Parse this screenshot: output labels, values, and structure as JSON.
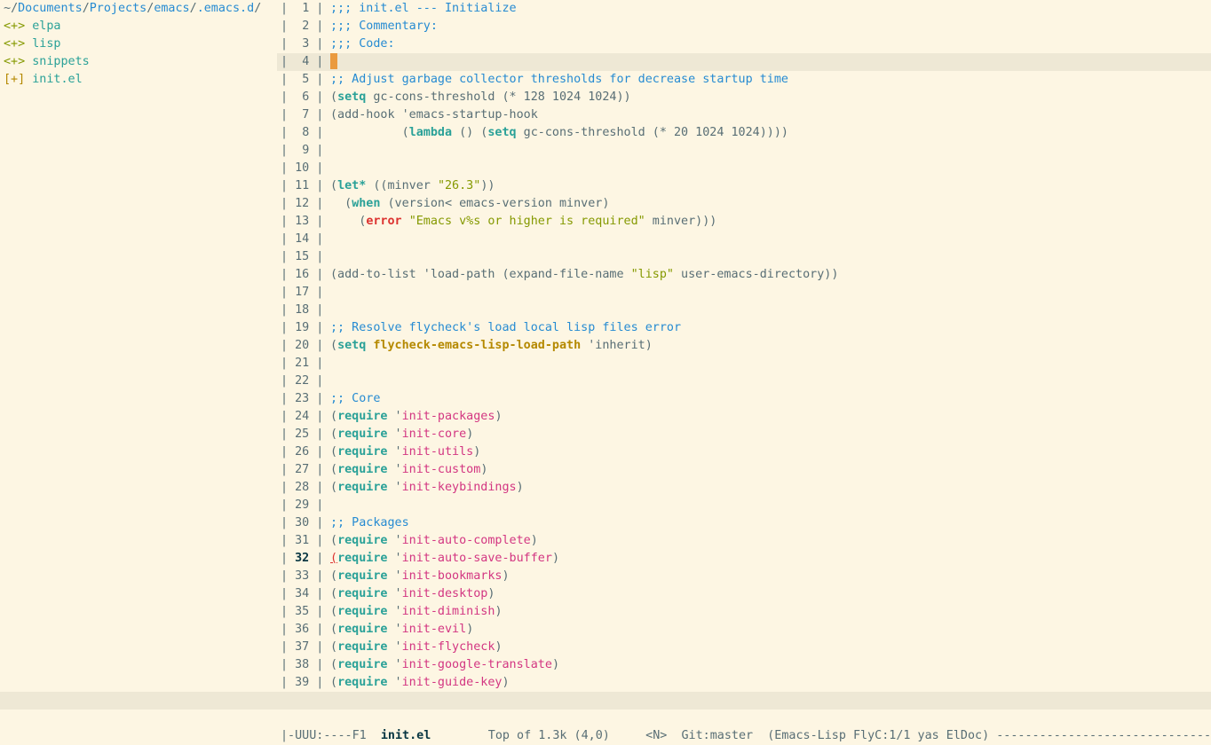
{
  "neotree": {
    "path": {
      "prefix": "~",
      "seg1": "Documents",
      "seg2": "Projects",
      "seg3": "emacs",
      "seg4": ".emacs.d",
      "sep": "/"
    },
    "dirs": [
      {
        "mark": "<+>",
        "name": "elpa"
      },
      {
        "mark": "<+>",
        "name": "lisp"
      },
      {
        "mark": "<+>",
        "name": "snippets"
      }
    ],
    "files": [
      {
        "mark": "[+]",
        "name": "init.el"
      }
    ]
  },
  "editor": {
    "lines": [
      {
        "n": "1",
        "code": [
          {
            "t": ";;; init.el --- Initialize",
            "c": "comment"
          }
        ]
      },
      {
        "n": "2",
        "code": [
          {
            "t": ";;; Commentary:",
            "c": "comment"
          }
        ]
      },
      {
        "n": "3",
        "code": [
          {
            "t": ";;; Code:",
            "c": "comment"
          }
        ]
      },
      {
        "n": "4",
        "code": [],
        "cursor": true
      },
      {
        "n": "5",
        "code": [
          {
            "t": ";; Adjust garbage collector thresholds for decrease startup time",
            "c": "comment"
          }
        ]
      },
      {
        "n": "6",
        "code": [
          {
            "t": "(",
            "c": ""
          },
          {
            "t": "setq",
            "c": "kw"
          },
          {
            "t": " gc-cons-threshold (* 128 1024 1024))",
            "c": ""
          }
        ]
      },
      {
        "n": "7",
        "code": [
          {
            "t": "(add-hook 'emacs-startup-hook",
            "c": ""
          }
        ]
      },
      {
        "n": "8",
        "code": [
          {
            "t": "          (",
            "c": ""
          },
          {
            "t": "lambda",
            "c": "kw"
          },
          {
            "t": " () (",
            "c": ""
          },
          {
            "t": "setq",
            "c": "kw"
          },
          {
            "t": " gc-cons-threshold (* 20 1024 1024))))",
            "c": ""
          }
        ]
      },
      {
        "n": "9",
        "code": []
      },
      {
        "n": "10",
        "code": []
      },
      {
        "n": "11",
        "code": [
          {
            "t": "(",
            "c": ""
          },
          {
            "t": "let*",
            "c": "kw"
          },
          {
            "t": " ((minver ",
            "c": ""
          },
          {
            "t": "\"26.3\"",
            "c": "str"
          },
          {
            "t": "))",
            "c": ""
          }
        ]
      },
      {
        "n": "12",
        "code": [
          {
            "t": "  (",
            "c": ""
          },
          {
            "t": "when",
            "c": "kw"
          },
          {
            "t": " (version< emacs-version minver)",
            "c": ""
          }
        ]
      },
      {
        "n": "13",
        "code": [
          {
            "t": "    (",
            "c": ""
          },
          {
            "t": "error",
            "c": "err"
          },
          {
            "t": " ",
            "c": ""
          },
          {
            "t": "\"Emacs v%s or higher is required\"",
            "c": "str"
          },
          {
            "t": " minver)))",
            "c": ""
          }
        ]
      },
      {
        "n": "14",
        "code": []
      },
      {
        "n": "15",
        "code": []
      },
      {
        "n": "16",
        "code": [
          {
            "t": "(add-to-list 'load-path (expand-file-name ",
            "c": ""
          },
          {
            "t": "\"lisp\"",
            "c": "str"
          },
          {
            "t": " user-emacs-directory))",
            "c": ""
          }
        ]
      },
      {
        "n": "17",
        "code": []
      },
      {
        "n": "18",
        "code": []
      },
      {
        "n": "19",
        "code": [
          {
            "t": ";; Resolve flycheck's load local lisp files error",
            "c": "comment"
          }
        ]
      },
      {
        "n": "20",
        "code": [
          {
            "t": "(",
            "c": ""
          },
          {
            "t": "setq",
            "c": "kw"
          },
          {
            "t": " ",
            "c": ""
          },
          {
            "t": "flycheck-emacs-lisp-load-path",
            "c": "var"
          },
          {
            "t": " 'inherit)",
            "c": ""
          }
        ]
      },
      {
        "n": "21",
        "code": []
      },
      {
        "n": "22",
        "code": []
      },
      {
        "n": "23",
        "code": [
          {
            "t": ";; Core",
            "c": "comment"
          }
        ]
      },
      {
        "n": "24",
        "code": [
          {
            "t": "(",
            "c": ""
          },
          {
            "t": "require",
            "c": "kw"
          },
          {
            "t": " '",
            "c": ""
          },
          {
            "t": "init-packages",
            "c": "sym"
          },
          {
            "t": ")",
            "c": ""
          }
        ]
      },
      {
        "n": "25",
        "code": [
          {
            "t": "(",
            "c": ""
          },
          {
            "t": "require",
            "c": "kw"
          },
          {
            "t": " '",
            "c": ""
          },
          {
            "t": "init-core",
            "c": "sym"
          },
          {
            "t": ")",
            "c": ""
          }
        ]
      },
      {
        "n": "26",
        "code": [
          {
            "t": "(",
            "c": ""
          },
          {
            "t": "require",
            "c": "kw"
          },
          {
            "t": " '",
            "c": ""
          },
          {
            "t": "init-utils",
            "c": "sym"
          },
          {
            "t": ")",
            "c": ""
          }
        ]
      },
      {
        "n": "27",
        "code": [
          {
            "t": "(",
            "c": ""
          },
          {
            "t": "require",
            "c": "kw"
          },
          {
            "t": " '",
            "c": ""
          },
          {
            "t": "init-custom",
            "c": "sym"
          },
          {
            "t": ")",
            "c": ""
          }
        ]
      },
      {
        "n": "28",
        "code": [
          {
            "t": "(",
            "c": ""
          },
          {
            "t": "require",
            "c": "kw"
          },
          {
            "t": " '",
            "c": ""
          },
          {
            "t": "init-keybindings",
            "c": "sym"
          },
          {
            "t": ")",
            "c": ""
          }
        ]
      },
      {
        "n": "29",
        "code": []
      },
      {
        "n": "30",
        "code": [
          {
            "t": ";; Packages",
            "c": "comment"
          }
        ]
      },
      {
        "n": "31",
        "code": [
          {
            "t": "(",
            "c": ""
          },
          {
            "t": "require",
            "c": "kw"
          },
          {
            "t": " '",
            "c": ""
          },
          {
            "t": "init-auto-complete",
            "c": "sym"
          },
          {
            "t": ")",
            "c": ""
          }
        ]
      },
      {
        "n": "32",
        "bold": true,
        "code": [
          {
            "t": "(",
            "c": "perr"
          },
          {
            "t": "require",
            "c": "kw"
          },
          {
            "t": " '",
            "c": ""
          },
          {
            "t": "init-auto-save-buffer",
            "c": "sym"
          },
          {
            "t": ")",
            "c": ""
          }
        ]
      },
      {
        "n": "33",
        "code": [
          {
            "t": "(",
            "c": ""
          },
          {
            "t": "require",
            "c": "kw"
          },
          {
            "t": " '",
            "c": ""
          },
          {
            "t": "init-bookmarks",
            "c": "sym"
          },
          {
            "t": ")",
            "c": ""
          }
        ]
      },
      {
        "n": "34",
        "code": [
          {
            "t": "(",
            "c": ""
          },
          {
            "t": "require",
            "c": "kw"
          },
          {
            "t": " '",
            "c": ""
          },
          {
            "t": "init-desktop",
            "c": "sym"
          },
          {
            "t": ")",
            "c": ""
          }
        ]
      },
      {
        "n": "35",
        "code": [
          {
            "t": "(",
            "c": ""
          },
          {
            "t": "require",
            "c": "kw"
          },
          {
            "t": " '",
            "c": ""
          },
          {
            "t": "init-diminish",
            "c": "sym"
          },
          {
            "t": ")",
            "c": ""
          }
        ]
      },
      {
        "n": "36",
        "code": [
          {
            "t": "(",
            "c": ""
          },
          {
            "t": "require",
            "c": "kw"
          },
          {
            "t": " '",
            "c": ""
          },
          {
            "t": "init-evil",
            "c": "sym"
          },
          {
            "t": ")",
            "c": ""
          }
        ]
      },
      {
        "n": "37",
        "code": [
          {
            "t": "(",
            "c": ""
          },
          {
            "t": "require",
            "c": "kw"
          },
          {
            "t": " '",
            "c": ""
          },
          {
            "t": "init-flycheck",
            "c": "sym"
          },
          {
            "t": ")",
            "c": ""
          }
        ]
      },
      {
        "n": "38",
        "code": [
          {
            "t": "(",
            "c": ""
          },
          {
            "t": "require",
            "c": "kw"
          },
          {
            "t": " '",
            "c": ""
          },
          {
            "t": "init-google-translate",
            "c": "sym"
          },
          {
            "t": ")",
            "c": ""
          }
        ]
      },
      {
        "n": "39",
        "code": [
          {
            "t": "(",
            "c": ""
          },
          {
            "t": "require",
            "c": "kw"
          },
          {
            "t": " '",
            "c": ""
          },
          {
            "t": "init-guide-key",
            "c": "sym"
          },
          {
            "t": ")",
            "c": ""
          }
        ]
      }
    ]
  },
  "modeline": {
    "left": "<<",
    "status": "|-UUU:----F1  ",
    "buffer": "init.el",
    "position": "        Top of 1.3k (4,0)     <N>  Git:master  (Emacs-Lisp FlyC:1/1 yas ElDoc) ---------------------------------------------------------"
  }
}
